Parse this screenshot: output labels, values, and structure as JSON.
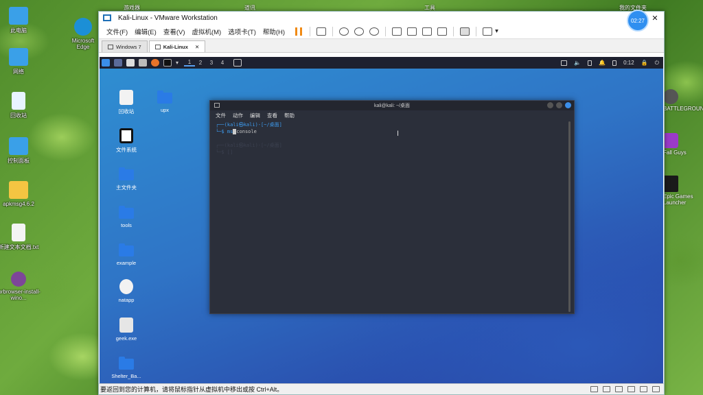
{
  "host": {
    "top_labels": [
      "游戏器",
      "道讯",
      "工具",
      "我的文件夹"
    ],
    "desktop_icons": [
      {
        "label": "此电脑",
        "icon": "computer-icon",
        "color": "#3aa0e8"
      },
      {
        "label": "网络",
        "icon": "network-icon",
        "color": "#3aa0e8"
      },
      {
        "label": "回收站",
        "icon": "recycle-bin-icon",
        "color": "#e8f4ff"
      },
      {
        "label": "控制面板",
        "icon": "control-panel-icon",
        "color": "#3aa0e8"
      },
      {
        "label": "apkmsg4.6.2",
        "icon": "folder-icon",
        "color": "#f4c542"
      },
      {
        "label": "新建文本文档.txt",
        "icon": "text-file-icon",
        "color": "#f4f4f4"
      },
      {
        "label": "torbrowser-install-wino...",
        "icon": "tor-icon",
        "color": "#7d4698"
      }
    ],
    "edge_label": "Microsoft Edge",
    "right_icons": [
      "BATTLEGROUNDS",
      "Fall Guys",
      "Epic Games Launcher"
    ]
  },
  "timer": "02:27",
  "vmware": {
    "title": "Kali-Linux - VMware Workstation",
    "menu": [
      "文件(F)",
      "编辑(E)",
      "查看(V)",
      "虚拟机(M)",
      "选项卡(T)",
      "帮助(H)"
    ],
    "tabs": [
      {
        "label": "Windows 7",
        "active": false
      },
      {
        "label": "Kali-Linux",
        "active": true
      }
    ],
    "status": "要返回到您的计算机，请将鼠标指针从虚拟机中移出或按 Ctrl+Alt。"
  },
  "kali": {
    "workspaces": [
      "1",
      "2",
      "3",
      "4"
    ],
    "clock": "0:12",
    "desktop_icons": [
      {
        "label": "回收站",
        "kind": "box"
      },
      {
        "label": "upx",
        "kind": "folder"
      },
      {
        "label": "文件系统",
        "kind": "box"
      },
      {
        "label": "主文件夹",
        "kind": "folder"
      },
      {
        "label": "tools",
        "kind": "folder"
      },
      {
        "label": "example",
        "kind": "folder"
      },
      {
        "label": "natapp",
        "kind": "box"
      },
      {
        "label": "geek.exe",
        "kind": "box"
      },
      {
        "label": "Shelter_Ba...",
        "kind": "folder"
      }
    ],
    "terminal": {
      "title": "kali@kali: ~/桌面",
      "menu": [
        "文件",
        "动作",
        "编辑",
        "查看",
        "帮助"
      ],
      "prompt": "┌──(kali㉿kali)-[~/桌面]",
      "command_prefix": "└─$ ms",
      "command_suffix": "console",
      "ghost_prompt": "┌──(kali㉿kali)-[~/桌面]",
      "ghost_cmd": "└─$ []"
    }
  }
}
